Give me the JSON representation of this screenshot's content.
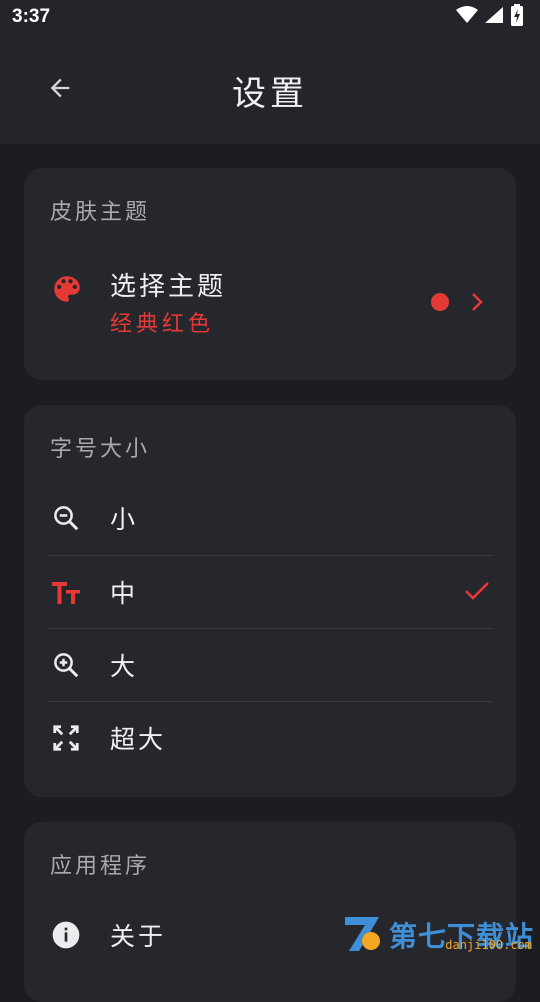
{
  "status_bar": {
    "time": "3:37"
  },
  "app_bar": {
    "title": "设置",
    "back_icon": "arrow-left-icon"
  },
  "skin_theme": {
    "section_title": "皮肤主题",
    "item": {
      "label": "选择主题",
      "value": "经典红色",
      "icon": "palette-icon",
      "accent": "#e53935"
    }
  },
  "font_size": {
    "section_title": "字号大小",
    "items": [
      {
        "label": "小",
        "icon": "zoom-out-icon",
        "selected": false
      },
      {
        "label": "中",
        "icon": "text-size-icon",
        "selected": true
      },
      {
        "label": "大",
        "icon": "zoom-in-icon",
        "selected": false
      },
      {
        "label": "超大",
        "icon": "fullscreen-icon",
        "selected": false
      }
    ]
  },
  "application": {
    "section_title": "应用程序",
    "items": [
      {
        "label": "关于",
        "icon": "info-icon"
      }
    ]
  },
  "watermark": {
    "text": "第七下载站",
    "url": "danji100.com"
  },
  "colors": {
    "background": "#1c1d22",
    "card": "#26272d",
    "accent": "#e53935",
    "text": "#f0f0f2",
    "muted": "#a9aab0"
  }
}
